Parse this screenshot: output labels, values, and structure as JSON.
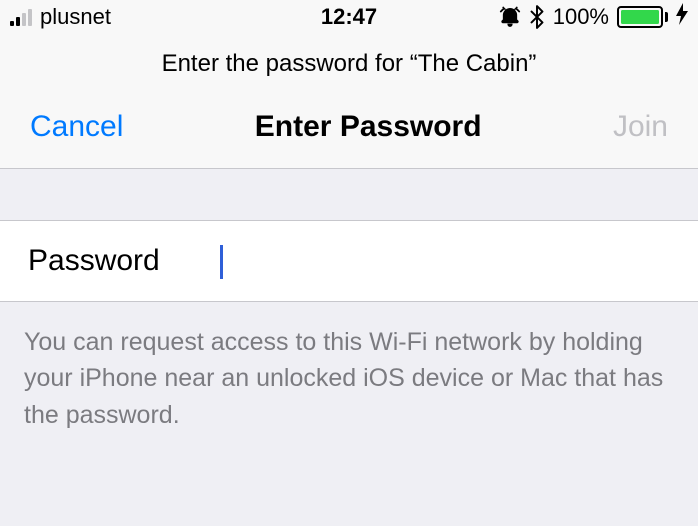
{
  "status": {
    "carrier": "plusnet",
    "time": "12:47",
    "battery_pct": "100%",
    "icons": {
      "alarm": "alarm-icon",
      "bluetooth": "bluetooth-icon",
      "bolt": "charging-bolt"
    }
  },
  "subtitle": "Enter the password for “The Cabin”",
  "nav": {
    "cancel": "Cancel",
    "title": "Enter Password",
    "join": "Join"
  },
  "password": {
    "label": "Password",
    "value": "",
    "placeholder": ""
  },
  "help": "You can request access to this Wi-Fi network by holding your iPhone near an unlocked iOS device or Mac that has the password."
}
